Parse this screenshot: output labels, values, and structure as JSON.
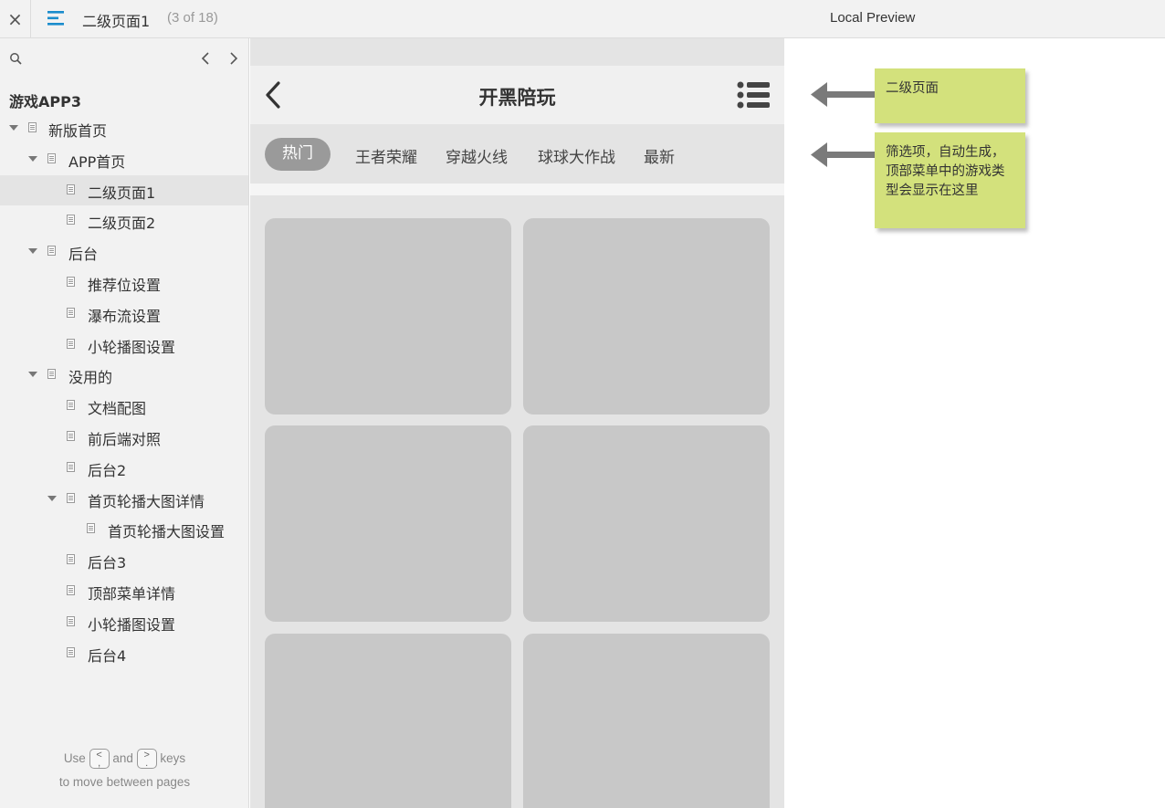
{
  "topbar": {
    "close_symbol": "×",
    "page_title": "二级页面1",
    "page_count": "(3 of 18)",
    "local_preview": "Local Preview"
  },
  "sidebar": {
    "project_title": "游戏APP3",
    "items": [
      {
        "label": "新版首页",
        "level": 0,
        "caret": true,
        "selected": false
      },
      {
        "label": "APP首页",
        "level": 1,
        "caret": true,
        "selected": false
      },
      {
        "label": "二级页面1",
        "level": 2,
        "caret": false,
        "selected": true
      },
      {
        "label": "二级页面2",
        "level": 2,
        "caret": false,
        "selected": false
      },
      {
        "label": "后台",
        "level": 1,
        "caret": true,
        "selected": false
      },
      {
        "label": "推荐位设置",
        "level": 2,
        "caret": false,
        "selected": false
      },
      {
        "label": "瀑布流设置",
        "level": 2,
        "caret": false,
        "selected": false
      },
      {
        "label": "小轮播图设置",
        "level": 2,
        "caret": false,
        "selected": false
      },
      {
        "label": "没用的",
        "level": 1,
        "caret": true,
        "selected": false
      },
      {
        "label": "文档配图",
        "level": 2,
        "caret": false,
        "selected": false
      },
      {
        "label": "前后端对照",
        "level": 2,
        "caret": false,
        "selected": false
      },
      {
        "label": "后台2",
        "level": 2,
        "caret": false,
        "selected": false
      },
      {
        "label": "首页轮播大图详情",
        "level": 2,
        "caret": true,
        "selected": false
      },
      {
        "label": "首页轮播大图设置",
        "level": 3,
        "caret": false,
        "selected": false
      },
      {
        "label": "后台3",
        "level": 2,
        "caret": false,
        "selected": false
      },
      {
        "label": "顶部菜单详情",
        "level": 2,
        "caret": false,
        "selected": false
      },
      {
        "label": "小轮播图设置",
        "level": 2,
        "caret": false,
        "selected": false
      },
      {
        "label": "后台4",
        "level": 2,
        "caret": false,
        "selected": false
      }
    ],
    "hint": {
      "use": "Use",
      "and": "and",
      "keys": "keys",
      "line2": "to move between pages",
      "prev_key": "<",
      "prev_key_sub": ",",
      "next_key": ">",
      "next_key_sub": "."
    }
  },
  "app": {
    "title": "开黑陪玩",
    "tabs": [
      "热门",
      "王者荣耀",
      "穿越火线",
      "球球大作战",
      "最新"
    ],
    "active_tab": 0
  },
  "notes": [
    {
      "text": "二级页面"
    },
    {
      "text": "筛选项，自动生成，顶部菜单中的游戏类型会显示在这里"
    }
  ],
  "colors": {
    "accent_menu": "#1a8ccc",
    "note_bg": "#d3e17c",
    "card_bg": "#c8c8c8",
    "active_tab_bg": "#9a9a9a"
  }
}
